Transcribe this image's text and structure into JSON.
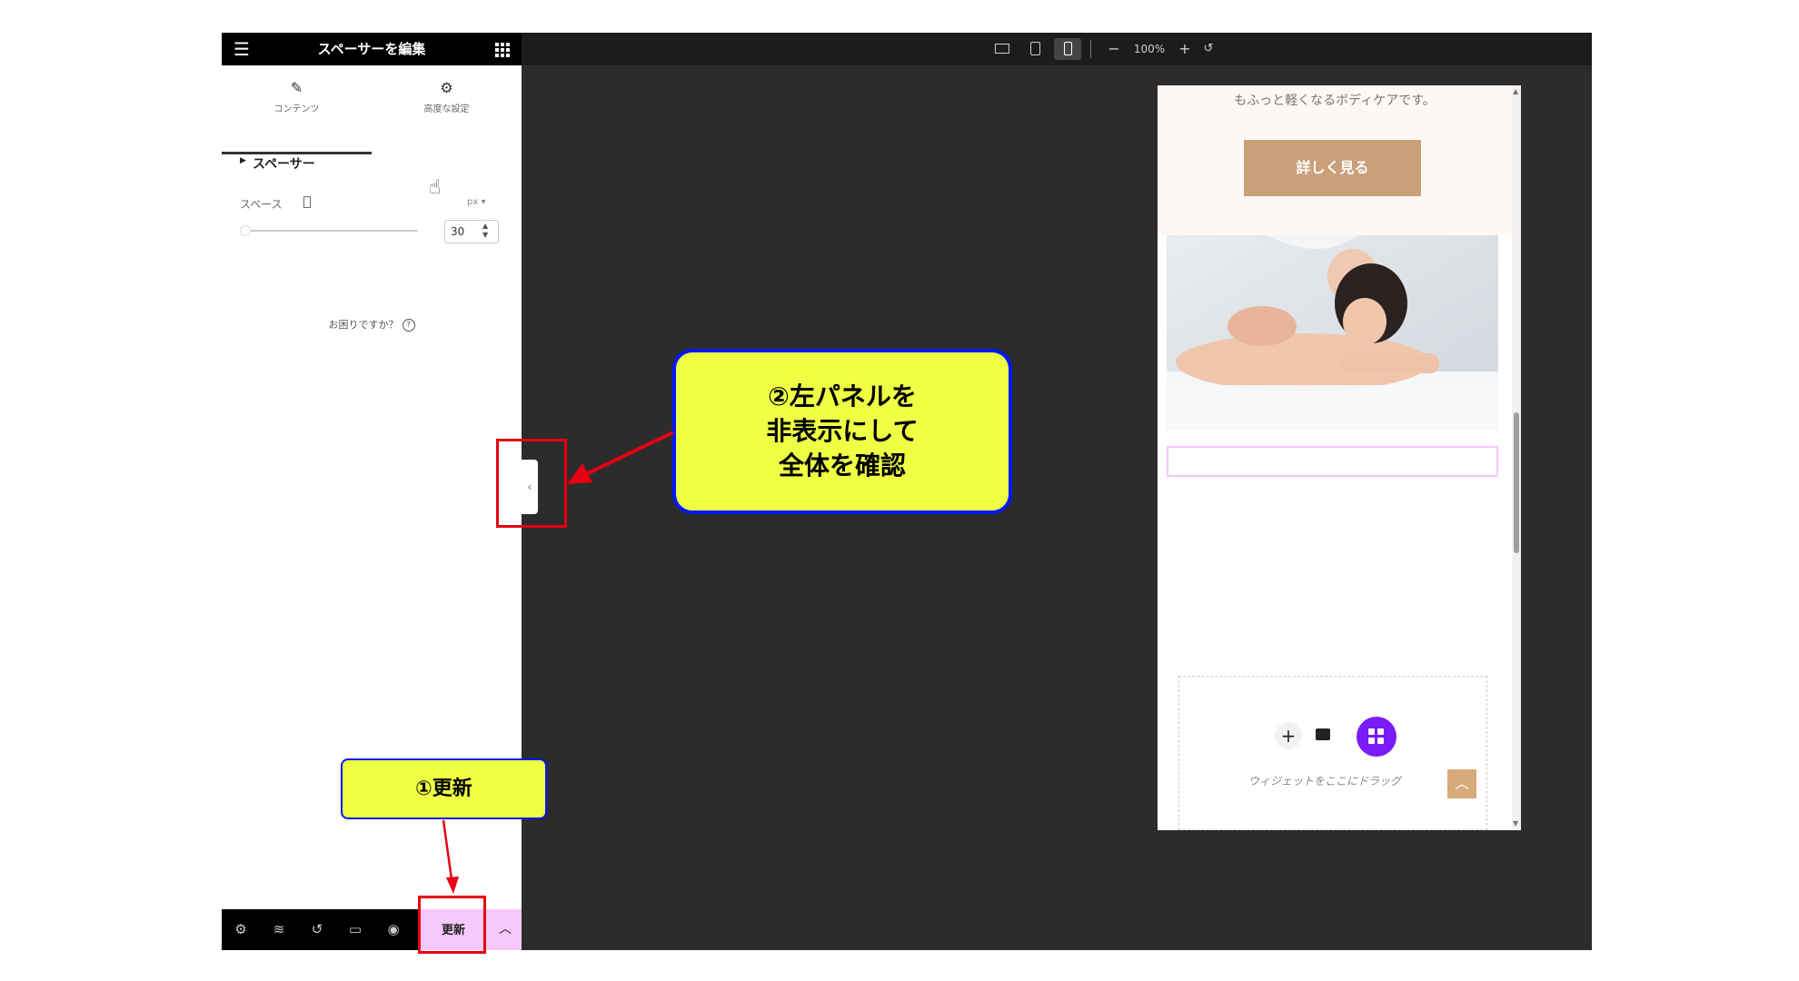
{
  "panel": {
    "title": "スペーサーを編集",
    "tabs": [
      {
        "label": "コンテンツ",
        "icon": "pencil-icon"
      },
      {
        "label": "高度な設定",
        "icon": "gear-icon"
      }
    ],
    "section_title": "スペーサー",
    "space_label": "スペース",
    "unit": "px",
    "space_value": "30",
    "slider_value": 30,
    "help_text": "お困りですか？"
  },
  "footer": {
    "icons": [
      "settings-icon",
      "layers-icon",
      "history-icon",
      "responsive-icon",
      "eye-icon"
    ],
    "update_label": "更新"
  },
  "toolbar": {
    "zoom": "100%",
    "zoom_out": "−",
    "zoom_in": "+"
  },
  "preview": {
    "subtitle": "もふっと軽くなるボディケアです。",
    "button_label": "詳しく見る",
    "drop_text": "ウィジェットをここにドラッグ"
  },
  "annotations": {
    "callout_2_lines": [
      "②左パネルを",
      "非表示にして",
      "全体を確認"
    ],
    "callout_1": "①更新"
  },
  "colors": {
    "callout_fill": "#eeff44",
    "callout_border": "#0018ff",
    "highlight": "#e60012",
    "update_button": "#f7c8fb",
    "accent_purple": "#7a1cf7",
    "brand_tan": "#c9a07a"
  }
}
